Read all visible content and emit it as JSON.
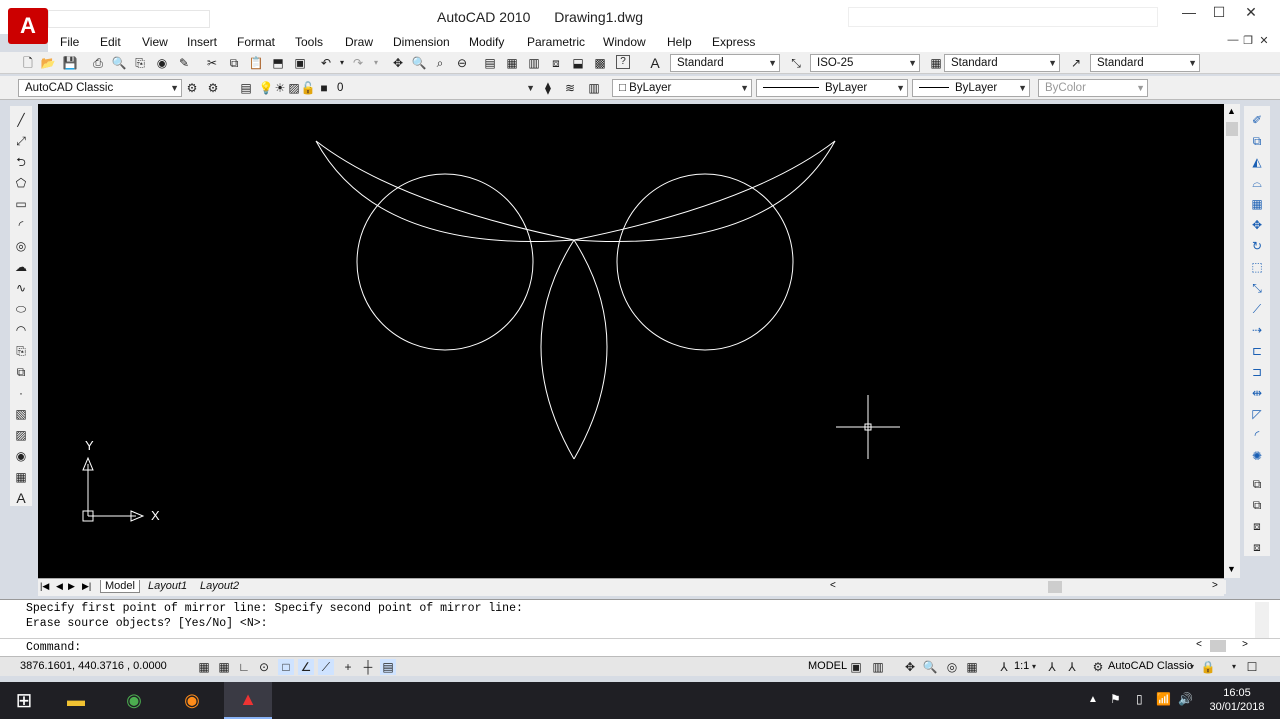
{
  "titlebar": {
    "app_name": "AutoCAD 2010",
    "document": "Drawing1.dwg",
    "app_icon_label": "A"
  },
  "window_controls": {
    "minimize": "—",
    "maximize": "☐",
    "close": "✕"
  },
  "document_controls": {
    "minimize": "—",
    "restore": "❐",
    "close": "✕"
  },
  "menu": [
    "File",
    "Edit",
    "View",
    "Insert",
    "Format",
    "Tools",
    "Draw",
    "Dimension",
    "Modify",
    "Parametric",
    "Window",
    "Help",
    "Express"
  ],
  "styles_toolbar": {
    "text_style": "Standard",
    "dim_style": "ISO-25",
    "table_style": "Standard",
    "multileader_style": "Standard"
  },
  "workspace_toolbar": {
    "workspace": "AutoCAD Classic",
    "layer": "0",
    "color": "ByLayer",
    "linetype": "ByLayer",
    "lineweight": "ByLayer",
    "plotstyle": "ByColor"
  },
  "ucs": {
    "x_label": "X",
    "y_label": "Y"
  },
  "layout_tabs": [
    "Model",
    "Layout1",
    "Layout2"
  ],
  "command_line": {
    "history": [
      "Specify first point of mirror line: Specify second point of mirror line:",
      "Erase source objects? [Yes/No] <N>:"
    ],
    "prompt": "Command:"
  },
  "status": {
    "coordinates": "3876.1601, 440.3716 , 0.0000",
    "model": "MODEL",
    "annotation_scale": "1:1",
    "workspace": "AutoCAD Classic"
  },
  "taskbar": {
    "time": "16:05",
    "date": "30/01/2018"
  },
  "colors": {
    "canvas": "#000000",
    "geometry": "#ffffff",
    "app_red": "#cc0000"
  }
}
